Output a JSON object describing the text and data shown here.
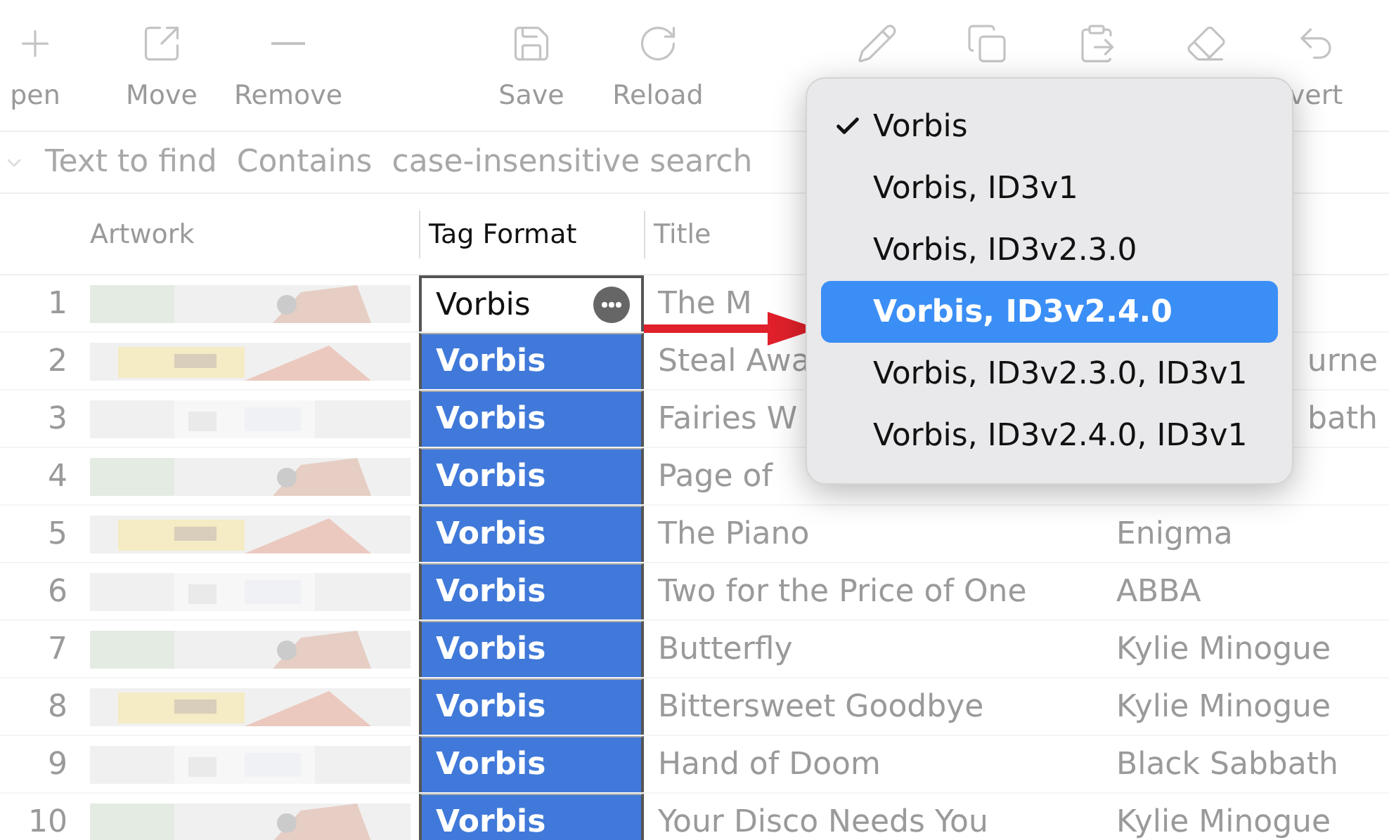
{
  "toolbar": [
    "pen",
    "Move",
    "Remove",
    "Save",
    "Reload",
    "vert"
  ],
  "search": {
    "field": "Text to find",
    "mode": "Contains",
    "option": "case-insensitive search"
  },
  "table": {
    "columns": [
      {
        "label": "Artwork",
        "active": false
      },
      {
        "label": "Tag Format",
        "active": true
      },
      {
        "label": "Title",
        "active": false
      }
    ],
    "rows": [
      {
        "number": "1",
        "tag_format": "Vorbis",
        "editing": true,
        "title": "The M"
      },
      {
        "number": "2",
        "tag_format": "Vorbis",
        "editing": false,
        "title": "Steal Awa",
        "column_5": "urne"
      },
      {
        "number": "3",
        "tag_format": "Vorbis",
        "editing": false,
        "title": "Fairies W",
        "column_5": "bath"
      },
      {
        "number": "4",
        "tag_format": "Vorbis",
        "editing": false,
        "title": "Page of"
      },
      {
        "number": "5",
        "tag_format": "Vorbis",
        "editing": false,
        "title": "The Piano",
        "column_5": "Enigma"
      },
      {
        "number": "6",
        "tag_format": "Vorbis",
        "editing": false,
        "title": "Two for the Price of One",
        "column_5": "ABBA"
      },
      {
        "number": "7",
        "tag_format": "Vorbis",
        "editing": false,
        "title": "Butterfly",
        "column_5": "Kylie Minogue"
      },
      {
        "number": "8",
        "tag_format": "Vorbis",
        "editing": false,
        "title": "Bittersweet Goodbye",
        "column_5": "Kylie Minogue"
      },
      {
        "number": "9",
        "tag_format": "Vorbis",
        "editing": false,
        "title": "Hand of Doom",
        "column_5": "Black Sabbath"
      },
      {
        "number": "10",
        "tag_format": "Vorbis",
        "editing": false,
        "title": "Your Disco Needs You",
        "column_5": "Kylie Minogue"
      }
    ]
  },
  "menu": {
    "items": [
      {
        "label": "Vorbis",
        "checked": true,
        "selected": false
      },
      {
        "label": "Vorbis, ID3v1",
        "checked": false,
        "selected": false
      },
      {
        "label": "Vorbis, ID3v2.3.0",
        "checked": false,
        "selected": false
      },
      {
        "label": "Vorbis, ID3v2.4.0",
        "checked": false,
        "selected": true
      },
      {
        "label": "Vorbis, ID3v2.3.0, ID3v1",
        "checked": false,
        "selected": false
      },
      {
        "label": "Vorbis, ID3v2.4.0, ID3v1",
        "checked": false,
        "selected": false
      }
    ]
  }
}
